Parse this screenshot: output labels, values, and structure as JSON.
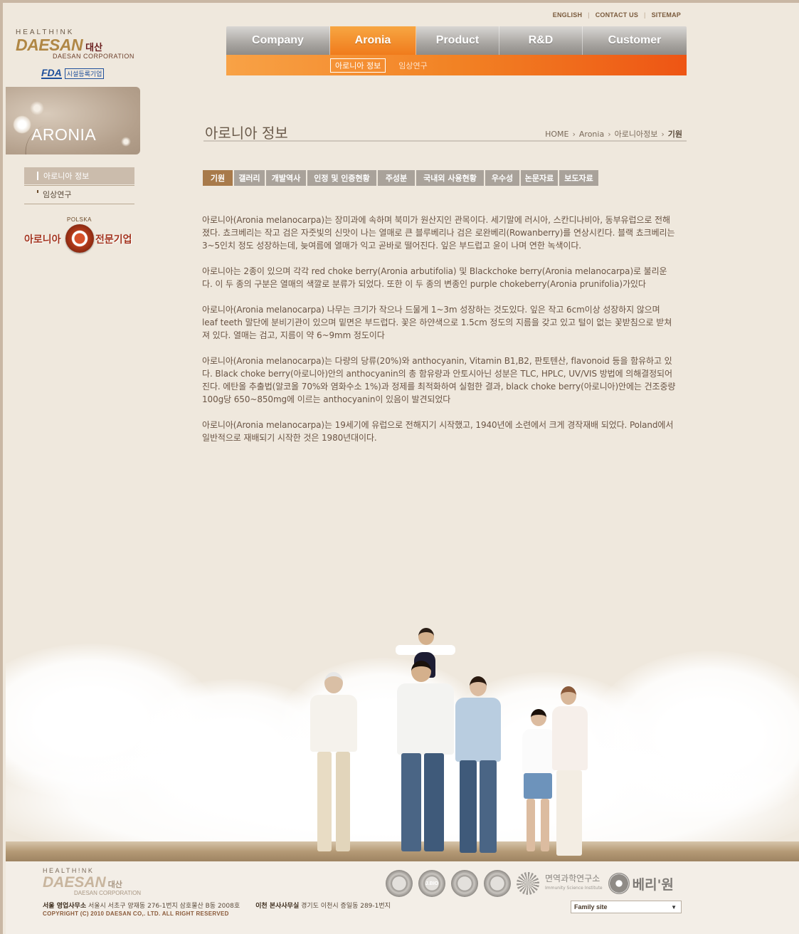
{
  "util_links": [
    "ENGLISH",
    "CONTACT US",
    "SITEMAP"
  ],
  "logo": {
    "tagline": "HEALTH!NK",
    "brand": "DAESAN",
    "brand_ko": "대산",
    "corp": "DAESAN CORPORATION",
    "fda": "FDA",
    "fda_label": "시설등록기업"
  },
  "nav": {
    "items": [
      {
        "label": "Company",
        "w": 146
      },
      {
        "label": "Aronia",
        "w": 121,
        "active": true
      },
      {
        "label": "Product",
        "w": 117
      },
      {
        "label": "R&D",
        "w": 117
      },
      {
        "label": "Customer",
        "w": 146
      }
    ],
    "sub": [
      "아로니아 정보",
      "임상연구"
    ]
  },
  "left": {
    "banner_title": "ARONIA",
    "menu": [
      "아로니아 정보",
      "임상연구"
    ],
    "badge_top": "POLSKA",
    "badge_left": "아로니아",
    "badge_right": "전문기업"
  },
  "page": {
    "title": "아로니아 정보",
    "breadcrumb": [
      "HOME",
      "Aronia",
      "아로니아정보",
      "기원"
    ]
  },
  "tabs": [
    "기원",
    "갤러리",
    "개발역사",
    "인정 및 인증현황",
    "주성분",
    "국내외 사용현황",
    "우수성",
    "논문자료",
    "보도자료"
  ],
  "content": [
    "아로니아(Aronia melanocarpa)는 장미과에 속하며 북미가 원산지인 관목이다. 세기말에 러시아, 스칸디나비아, 동부유럽으로 전해졌다. 쵸크베리는 작고 검은 자줏빛의 신맛이 나는 열매로 큰 블루베리나 검은 로완베리(Rowanberry)를 연상시킨다. 블랙 쵸크베리는 3~5인치 정도 성장하는데, 늦여름에 열매가 익고 곧바로 떨어진다. 잎은 부드럽고 윤이 나며 연한 녹색이다.",
    "아로니아는 2종이 있으며 각각 red choke berry(Aronia arbutifolia) 및 Blackchoke berry(Aronia melanocarpa)로 불리운다. 이 두 종의 구분은 열매의 색깔로 분류가 되었다. 또한 이 두 종의 변종인 purple chokeberry(Aronia prunifolia)가있다",
    "아로니아(Aronia melanocarpa) 나무는 크기가 작으나 드물게 1~3m 성장하는 것도있다. 잎은 작고 6cm이상 성장하지 않으며 leaf teeth 말단에 분비기관이 있으며 밑면은 부드럽다. 꽃은 하얀색으로 1.5cm 정도의 지름을 갖고 있고 털이 없는 꽃받침으로 받쳐져 있다. 열매는 검고, 지름이 약 6~9mm 정도이다",
    "아로니아(Aronia melanocarpa)는 다량의 당류(20%)와 anthocyanin, Vitamin B1,B2, 판토텐산, flavonoid 등을 함유하고 있다. Black choke berry(아로니아)안의 anthocyanin의 총 함유량과 안토시아닌 성분은 TLC, HPLC, UV/VIS 방법에 의해결정되어진다. 에탄올 추출법(알코올 70%와 염화수소 1%)과 정제를 최적화하여 실험한 결과, black choke berry(아로니아)안에는 건조중량 100g당 650~850mg에 이르는 anthocyanin이 있음이 발견되었다",
    "아로니아(Aronia melanocarpa)는 19세기에 유럽으로 전해지기 시작했고, 1940년에 소련에서 크게 경작재배 되었다. Poland에서 일반적으로 재배되기 시작한 것은 1980년대이다."
  ],
  "footer": {
    "tagline": "HEALTH!NK",
    "brand": "DAESAN",
    "brand_ko": "대산",
    "corp": "DAESAN CORPORATION",
    "office1_label": "서울 영업사무소",
    "office1_addr": "서울시 서초구 양재동 276-1번지 삼호물산 B동 2008호",
    "office2_label": "이천 본사사무실",
    "office2_addr": "경기도 이천시 증일동  289-1번지",
    "copyright": "COPYRIGHT (C) 2010 DAESAN CO,. LTD. ALL RIGHT RESERVED",
    "cert_labels": [
      "",
      "J.BIO",
      "",
      ""
    ],
    "institute": "면역과학연구소",
    "institute_en": "Immunity Science Institute",
    "berry": "베리'원",
    "family_site": "Family site"
  }
}
